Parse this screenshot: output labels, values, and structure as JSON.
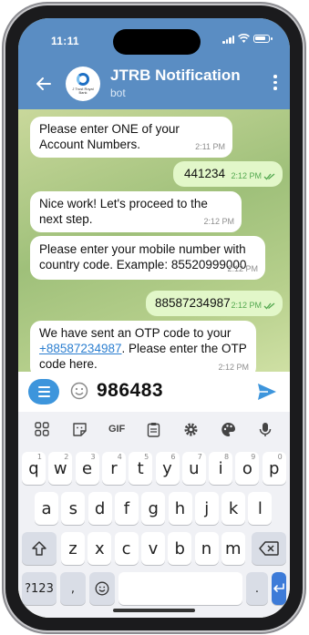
{
  "status": {
    "time": "11:11"
  },
  "header": {
    "title": "JTRB Notification",
    "subtitle": "bot",
    "logo_text": "J Trust Royal Bank"
  },
  "messages": [
    {
      "dir": "in",
      "text": "Please enter ONE of your Account Numbers.",
      "time": "2:11 PM"
    },
    {
      "dir": "out",
      "text": "441234",
      "time": "2:12 PM"
    },
    {
      "dir": "in",
      "text": "Nice work! Let's proceed to the next step.",
      "time": "2:12 PM"
    },
    {
      "dir": "in",
      "text": "Please enter your mobile number with country code. Example: 85520999000",
      "time": "2:12 PM"
    },
    {
      "dir": "out",
      "text": "88587234987",
      "time": "2:12 PM"
    },
    {
      "dir": "in",
      "text_before": "We have sent an OTP code to your ",
      "link": "+88587234987",
      "text_after": ". Please enter the OTP code here.",
      "time": "2:12 PM"
    }
  ],
  "composer": {
    "value": "986483"
  },
  "keyboard": {
    "toolbar": [
      "grid-icon",
      "sticker-icon",
      "GIF",
      "clipboard-icon",
      "gear-icon",
      "palette-icon",
      "mic-icon"
    ],
    "gif_label": "GIF",
    "row1": [
      "q",
      "w",
      "e",
      "r",
      "t",
      "y",
      "u",
      "i",
      "o",
      "p"
    ],
    "row1_hints": [
      "1",
      "2",
      "3",
      "4",
      "5",
      "6",
      "7",
      "8",
      "9",
      "0"
    ],
    "row2": [
      "a",
      "s",
      "d",
      "f",
      "g",
      "h",
      "j",
      "k",
      "l"
    ],
    "row3": [
      "z",
      "x",
      "c",
      "v",
      "b",
      "n",
      "m"
    ],
    "bottom": {
      "sym": "?123",
      "comma": ",",
      "period": "."
    }
  },
  "colors": {
    "header": "#5a8dc3",
    "outgoing": "#e2f7c9",
    "accent": "#3d95dc",
    "enter": "#3d7bd8"
  }
}
